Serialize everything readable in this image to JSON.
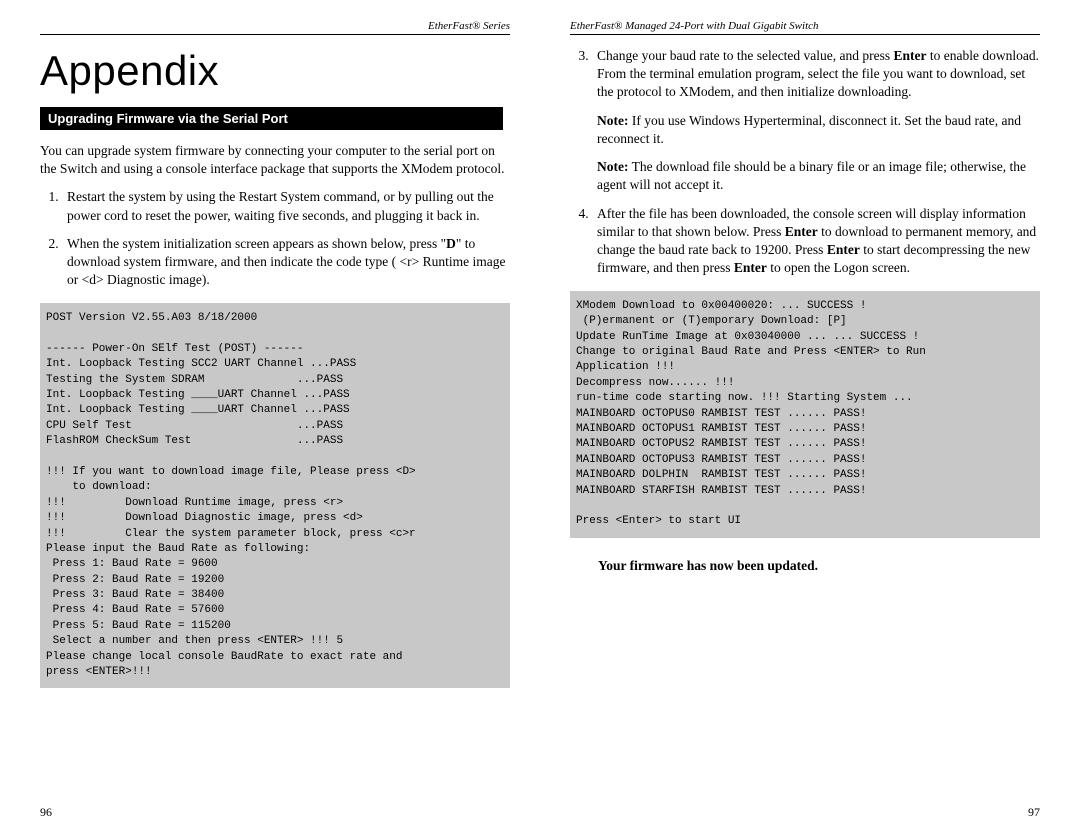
{
  "left": {
    "header": "EtherFast® Series",
    "title": "Appendix",
    "section_bar": "Upgrading Firmware via the Serial Port",
    "intro": "You can upgrade system firmware by connecting your computer to the serial port on the Switch and using a console interface package that supports the XModem protocol.",
    "step1": "Restart the system by using the Restart System command, or by pulling out the power cord to reset the power, waiting five seconds, and plugging it back in.",
    "step2_a": "When the system initialization screen appears as shown below, press \"",
    "step2_b": "D",
    "step2_c": "\" to download system firmware, and then indicate the code type ( <r> Runtime image or <d> Diagnostic image).",
    "terminal": "POST Version V2.55.A03 8/18/2000\n\n------ Power-On SElf Test (POST) ------\nInt. Loopback Testing SCC2 UART Channel ...PASS\nTesting the System SDRAM              ...PASS\nInt. Loopback Testing ____UART Channel ...PASS\nInt. Loopback Testing ____UART Channel ...PASS\nCPU Self Test                         ...PASS\nFlashROM CheckSum Test                ...PASS\n\n!!! If you want to download image file, Please press <D>\n    to download:\n!!!         Download Runtime image, press <r>\n!!!         Download Diagnostic image, press <d>\n!!!         Clear the system parameter block, press <c>r\nPlease input the Baud Rate as following:\n Press 1: Baud Rate = 9600\n Press 2: Baud Rate = 19200\n Press 3: Baud Rate = 38400\n Press 4: Baud Rate = 57600\n Press 5: Baud Rate = 115200\n Select a number and then press <ENTER> !!! 5\nPlease change local console BaudRate to exact rate and\npress <ENTER>!!!",
    "page_num": "96"
  },
  "right": {
    "header": "EtherFast® Managed 24-Port with Dual Gigabit Switch",
    "step3_a": "Change your baud rate to the selected value, and press ",
    "step3_b": "Enter",
    "step3_c": " to enable download. From the terminal emulation program, select the file you want to download, set the protocol to XModem, and then initialize downloading.",
    "note1_label": "Note:",
    "note1_text": " If you use Windows Hyperterminal, disconnect it. Set the baud rate, and reconnect it.",
    "note2_label": "Note:",
    "note2_text": " The download file should be a binary file or an image file; otherwise, the agent will not accept it.",
    "step4_a": "After the file has been downloaded, the console screen will display information similar to that shown below. Press ",
    "step4_b": "Enter",
    "step4_c": " to download to permanent memory, and change the baud rate back to 19200. Press ",
    "step4_d": "Enter",
    "step4_e": " to start decompressing the new firmware, and then press ",
    "step4_f": "Enter",
    "step4_g": " to open the Logon screen.",
    "terminal": "XModem Download to 0x00400020: ... SUCCESS !\n (P)ermanent or (T)emporary Download: [P]\nUpdate RunTime Image at 0x03040000 ... ... SUCCESS !\nChange to original Baud Rate and Press <ENTER> to Run\nApplication !!!\nDecompress now...... !!!\nrun-time code starting now. !!! Starting System ...\nMAINBOARD OCTOPUS0 RAMBIST TEST ...... PASS!\nMAINBOARD OCTOPUS1 RAMBIST TEST ...... PASS!\nMAINBOARD OCTOPUS2 RAMBIST TEST ...... PASS!\nMAINBOARD OCTOPUS3 RAMBIST TEST ...... PASS!\nMAINBOARD DOLPHIN  RAMBIST TEST ...... PASS!\nMAINBOARD STARFISH RAMBIST TEST ...... PASS!\n\nPress <Enter> to start UI",
    "final": "Your firmware has now been updated.",
    "page_num": "97"
  }
}
